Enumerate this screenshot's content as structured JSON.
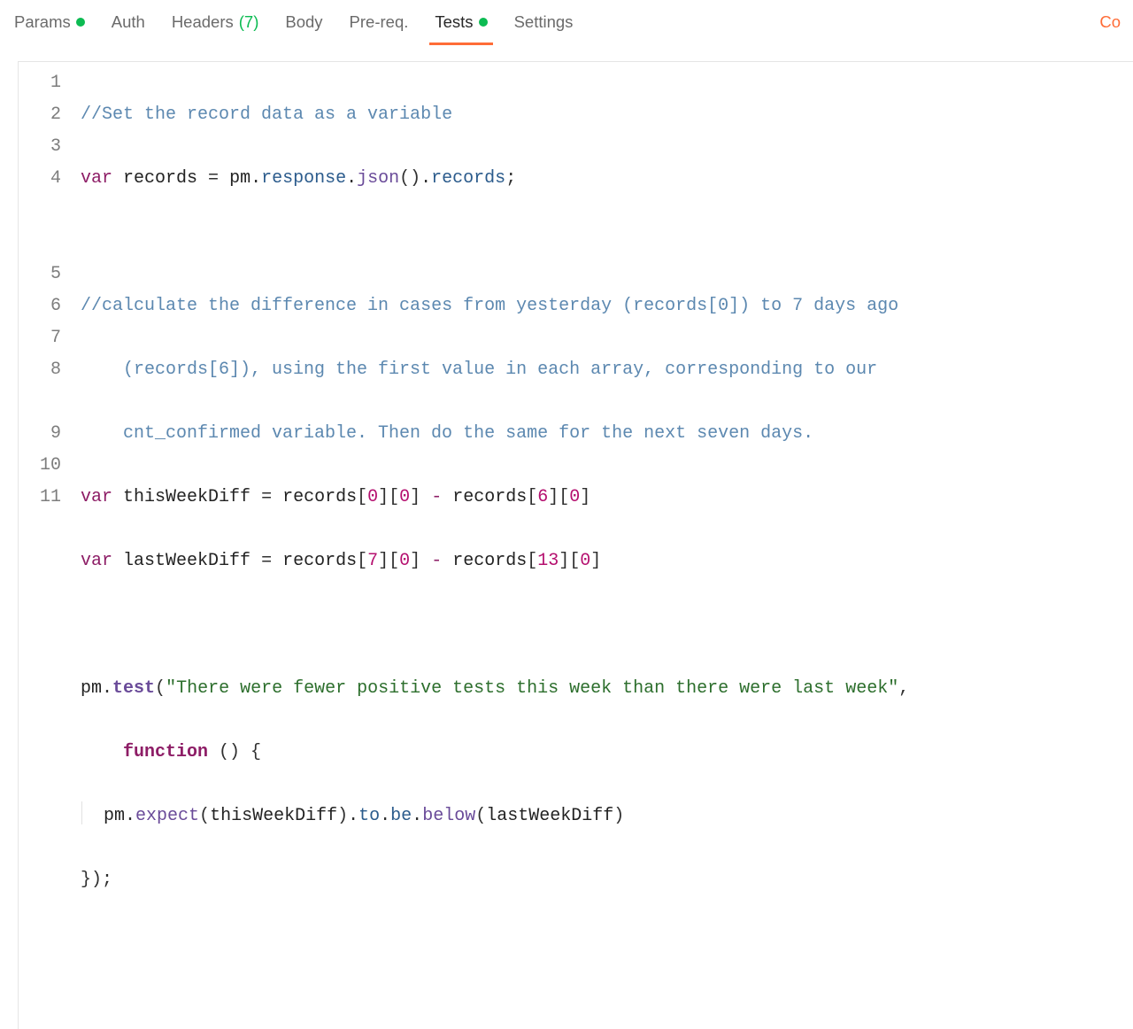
{
  "accent": "#ff6c37",
  "statusGreen": "#0cbb52",
  "tabs": {
    "params": {
      "label": "Params",
      "hasDot": true,
      "count": null,
      "active": false
    },
    "auth": {
      "label": "Auth",
      "hasDot": false,
      "count": null,
      "active": false
    },
    "headers": {
      "label": "Headers",
      "hasDot": false,
      "count": "(7)",
      "active": false
    },
    "body": {
      "label": "Body",
      "hasDot": false,
      "count": null,
      "active": false
    },
    "prereq": {
      "label": "Pre-req.",
      "hasDot": false,
      "count": null,
      "active": false
    },
    "tests": {
      "label": "Tests",
      "hasDot": true,
      "count": null,
      "active": true
    },
    "settings": {
      "label": "Settings",
      "hasDot": false,
      "count": null,
      "active": false
    }
  },
  "rightLink": "Co",
  "code": {
    "lineNumbers": [
      "1",
      "2",
      "3",
      "4",
      "5",
      "6",
      "7",
      "8",
      "9",
      "10",
      "11"
    ],
    "l1_comment": "//Set the record data as a variable",
    "l2_var": "var",
    "l2_records": "records",
    "l2_eq": " = ",
    "l2_pm": "pm",
    "l2_dot1": ".",
    "l2_response": "response",
    "l2_dot2": ".",
    "l2_json": "json",
    "l2_paren": "()",
    "l2_dot3": ".",
    "l2_records2": "records",
    "l2_semi": ";",
    "l4_a": "//calculate the difference in cases from yesterday (records[0]) to 7 days ago ",
    "l4_b": "(records[6]), using the first value in each array, corresponding to our ",
    "l4_c": "cnt_confirmed variable. Then do the same for the next seven days.",
    "l5_var": "var",
    "l5_name": "thisWeekDiff",
    "l5_eq": " = ",
    "l5_rec1": "records",
    "l5_lb1": "[",
    "l5_n0a": "0",
    "l5_rb1": "]",
    "l5_lb2": "[",
    "l5_n0b": "0",
    "l5_rb2": "]",
    "l5_minus": " - ",
    "l5_rec2": "records",
    "l5_lb3": "[",
    "l5_n6": "6",
    "l5_rb3": "]",
    "l5_lb4": "[",
    "l5_n0c": "0",
    "l5_rb4": "]",
    "l6_var": "var",
    "l6_name": "lastWeekDiff",
    "l6_eq": " = ",
    "l6_rec1": "records",
    "l6_lb1": "[",
    "l6_n7": "7",
    "l6_rb1": "]",
    "l6_lb2": "[",
    "l6_n0a": "0",
    "l6_rb2": "]",
    "l6_minus": " - ",
    "l6_rec2": "records",
    "l6_lb3": "[",
    "l6_n13": "13",
    "l6_rb3": "]",
    "l6_lb4": "[",
    "l6_n0b": "0",
    "l6_rb4": "]",
    "l8_pm": "pm",
    "l8_dot": ".",
    "l8_test": "test",
    "l8_lp": "(",
    "l8_str": "\"There were fewer positive tests this week than there were last week\"",
    "l8_comma": ", ",
    "l8w_func": "function",
    "l8w_paren": " () ",
    "l8w_brace": "{",
    "l9_pm": "pm",
    "l9_d1": ".",
    "l9_expect": "expect",
    "l9_lp": "(",
    "l9_arg1": "thisWeekDiff",
    "l9_rp": ")",
    "l9_d2": ".",
    "l9_to": "to",
    "l9_d3": ".",
    "l9_be": "be",
    "l9_d4": ".",
    "l9_below": "below",
    "l9_lp2": "(",
    "l9_arg2": "lastWeekDiff",
    "l9_rp2": ")",
    "l10": "});"
  }
}
